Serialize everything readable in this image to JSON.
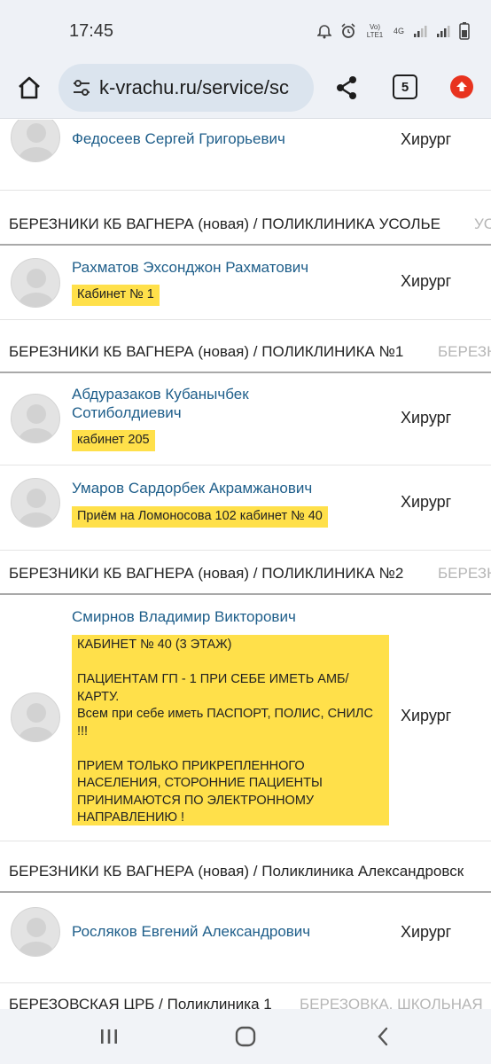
{
  "status_bar": {
    "time": "17:45",
    "network_label": "Vo) LTE1",
    "network_type": "4G"
  },
  "browser": {
    "url": "k-vrachu.ru/service/sc",
    "tab_count": "5"
  },
  "rows": [
    {
      "name": "Федосеев Сергей Григорьевич",
      "specialty": "Хирург"
    },
    {
      "name": "Рахматов Эхсонджон Рахматович",
      "note": "Кабинет № 1",
      "specialty": "Хирург"
    },
    {
      "name_line1": "Абдуразаков Кубанычбек",
      "name_line2": "Сотиболдиевич",
      "note": "кабинет 205",
      "specialty": "Хирург"
    },
    {
      "name": "Умаров Сардорбек Акрамжанович",
      "note": "Приём на Ломоносова 102 кабинет № 40",
      "specialty": "Хирург"
    },
    {
      "name": "Смирнов Владимир Викторович",
      "note_lines": [
        "КАБИНЕТ № 40 (3 ЭТАЖ)",
        "",
        "ПАЦИЕНТАМ ГП - 1 ПРИ СЕБЕ ИМЕТЬ АМБ/",
        "КАРТУ.",
        "Всем при себе иметь ПАСПОРТ, ПОЛИС, СНИЛС",
        "!!!",
        "",
        "ПРИЕМ ТОЛЬКО ПРИКРЕПЛЕННОГО",
        "НАСЕЛЕНИЯ, СТОРОННИЕ ПАЦИЕНТЫ",
        "ПРИНИМАЮТСЯ ПО ЭЛЕКТРОННОМУ",
        "НАПРАВЛЕНИЮ !"
      ],
      "specialty": "Хирург"
    },
    {
      "name": "Росляков Евгений Александрович",
      "specialty": "Хирург"
    }
  ],
  "sections": [
    {
      "title": "БЕРЕЗНИКИ КБ ВАГНЕРА (новая) / ПОЛИКЛИНИКА УСОЛЬЕ",
      "next": "УС"
    },
    {
      "title": "БЕРЕЗНИКИ КБ ВАГНЕРА (новая) / ПОЛИКЛИНИКА №1",
      "next": "БЕРЕЗН"
    },
    {
      "title": "БЕРЕЗНИКИ КБ ВАГНЕРА (новая) / ПОЛИКЛИНИКА №2",
      "next": "БЕРЕЗН"
    },
    {
      "title": "БЕРЕЗНИКИ КБ ВАГНЕРА (новая) / Поликлиника Александровск",
      "next": ""
    },
    {
      "title": "БЕРЕЗОВСКАЯ ЦРБ / Поликлиника 1",
      "next": "БЕРЕЗОВКА, ШКОЛЬНАЯ"
    }
  ],
  "colors": {
    "link": "#1e5e8a",
    "note_highlight": "#ffe04a",
    "update_badge": "#e8331f"
  }
}
